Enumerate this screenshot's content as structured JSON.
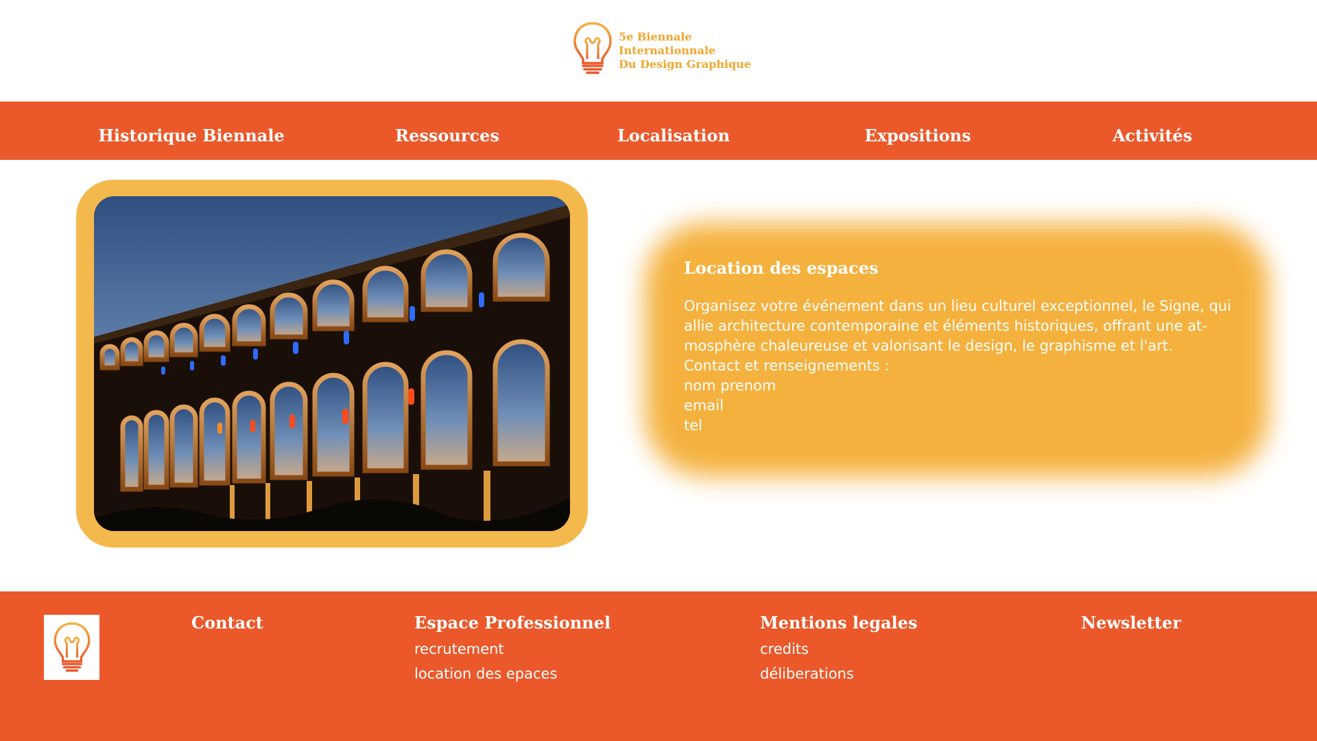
{
  "header": {
    "logo_lines": [
      "5e Biennale",
      "Internationnale",
      "Du Design Graphique"
    ],
    "logo_icon": "lightbulb-icon"
  },
  "nav": {
    "items": [
      {
        "label": "Historique Biennale"
      },
      {
        "label": "Ressources"
      },
      {
        "label": "Localisation"
      },
      {
        "label": "Expositions"
      },
      {
        "label": "Activités"
      }
    ]
  },
  "info": {
    "title": "Location des espaces",
    "lines": [
      "Organisez votre événement dans un lieu culturel exceptionnel, le Signe, qui",
      "allie architecture contemporaine et éléments historiques, offrant une at-",
      "mosphère chaleureuse et valorisant le design, le graphisme et l'art.",
      "Contact et renseignements :",
      "nom prenom",
      "email",
      "tel"
    ]
  },
  "footer": {
    "logo_icon": "lightbulb-icon",
    "columns": [
      {
        "heading": "Contact",
        "links": []
      },
      {
        "heading": "Espace Professionnel",
        "links": [
          "recrutement",
          "location des epaces"
        ]
      },
      {
        "heading": "Mentions legales",
        "links": [
          "credits",
          "déliberations"
        ]
      },
      {
        "heading": "Newsletter",
        "links": []
      }
    ]
  },
  "colors": {
    "brand_orange": "#eb582a",
    "accent_yellow": "#f4b94d",
    "logo_gold": "#f2a62e"
  }
}
